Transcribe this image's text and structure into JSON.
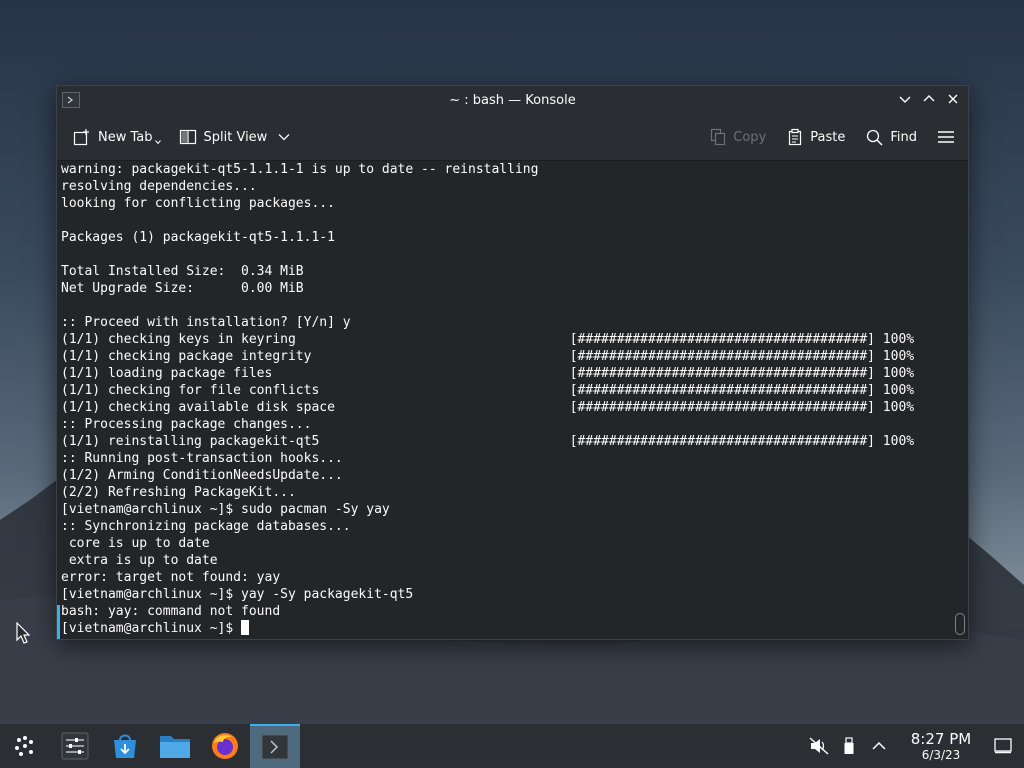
{
  "window": {
    "title": "~ : bash — Konsole"
  },
  "toolbar": {
    "new_tab": "New Tab",
    "split_view": "Split View",
    "copy": "Copy",
    "paste": "Paste",
    "find": "Find"
  },
  "terminal": {
    "lines": [
      "warning: packagekit-qt5-1.1.1-1 is up to date -- reinstalling",
      "resolving dependencies...",
      "looking for conflicting packages...",
      "",
      "Packages (1) packagekit-qt5-1.1.1-1",
      "",
      "Total Installed Size:  0.34 MiB",
      "Net Upgrade Size:      0.00 MiB",
      "",
      ":: Proceed with installation? [Y/n] y",
      "(1/1) checking keys in keyring                                   [#####################################] 100%",
      "(1/1) checking package integrity                                 [#####################################] 100%",
      "(1/1) loading package files                                      [#####################################] 100%",
      "(1/1) checking for file conflicts                                [#####################################] 100%",
      "(1/1) checking available disk space                              [#####################################] 100%",
      ":: Processing package changes...",
      "(1/1) reinstalling packagekit-qt5                                [#####################################] 100%",
      ":: Running post-transaction hooks...",
      "(1/2) Arming ConditionNeedsUpdate...",
      "(2/2) Refreshing PackageKit...",
      "[vietnam@archlinux ~]$ sudo pacman -Sy yay",
      ":: Synchronizing package databases...",
      " core is up to date",
      " extra is up to date",
      "error: target not found: yay",
      "[vietnam@archlinux ~]$ yay -Sy packagekit-qt5",
      "bash: yay: command not found",
      "[vietnam@archlinux ~]$ "
    ]
  },
  "taskbar": {
    "time": "8:27 PM",
    "date": "6/3/23"
  },
  "colors": {
    "accent": "#3daee9",
    "terminal_bg": "#232629",
    "terminal_fg": "#fcfcfc"
  },
  "icons": [
    "app-launcher-icon",
    "system-settings-icon",
    "discover-store-icon",
    "dolphin-files-icon",
    "firefox-icon",
    "konsole-icon",
    "volume-muted-icon",
    "usb-device-icon",
    "tray-expand-icon",
    "show-desktop-icon"
  ]
}
